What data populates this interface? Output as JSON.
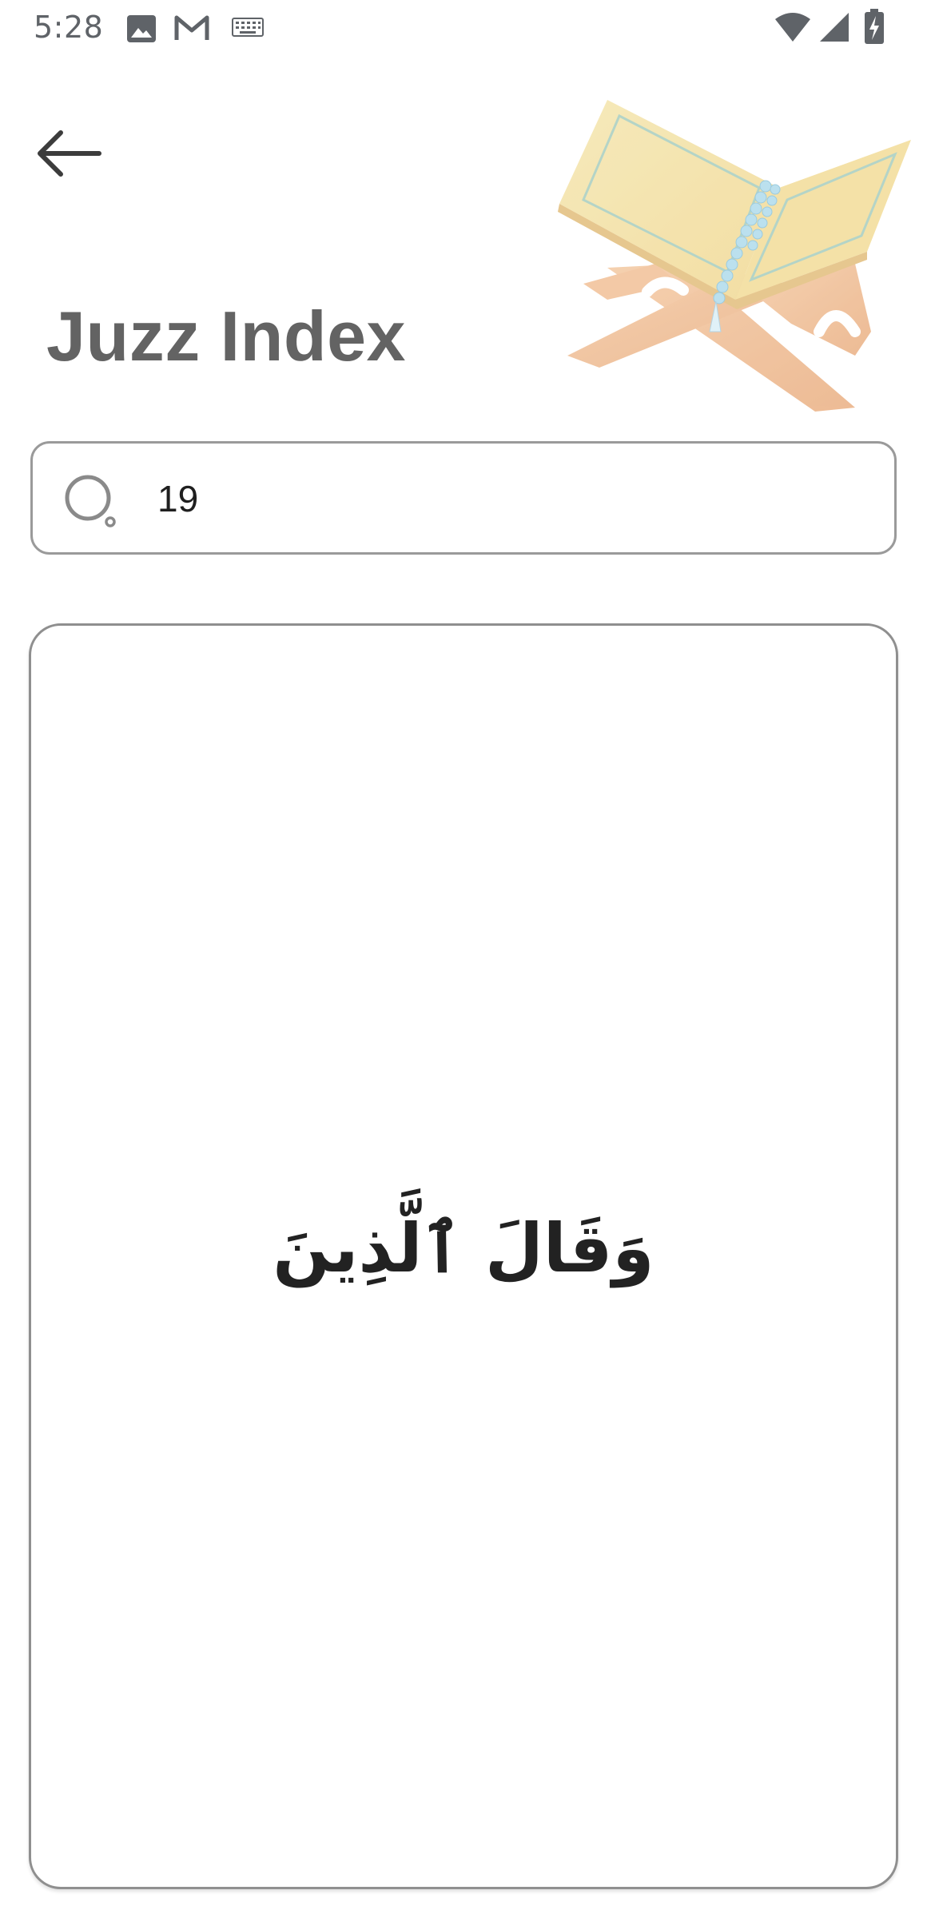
{
  "status_bar": {
    "time": "5:28",
    "left_icons": [
      "image-icon",
      "gmail-icon",
      "keyboard-icon"
    ],
    "right_icons": [
      "wifi-icon",
      "signal-icon",
      "battery-charging-icon"
    ]
  },
  "header": {
    "back_icon": "arrow-left-icon",
    "title": "Juzz Index",
    "illustration": "quran-book-on-stand"
  },
  "search": {
    "icon": "search-icon",
    "value": "19"
  },
  "result_card": {
    "arabic_text": "وَقَالَ ٱلَّذِينَ"
  },
  "colors": {
    "title": "#636363",
    "border": "#9a9a9a",
    "text": "#222222"
  }
}
